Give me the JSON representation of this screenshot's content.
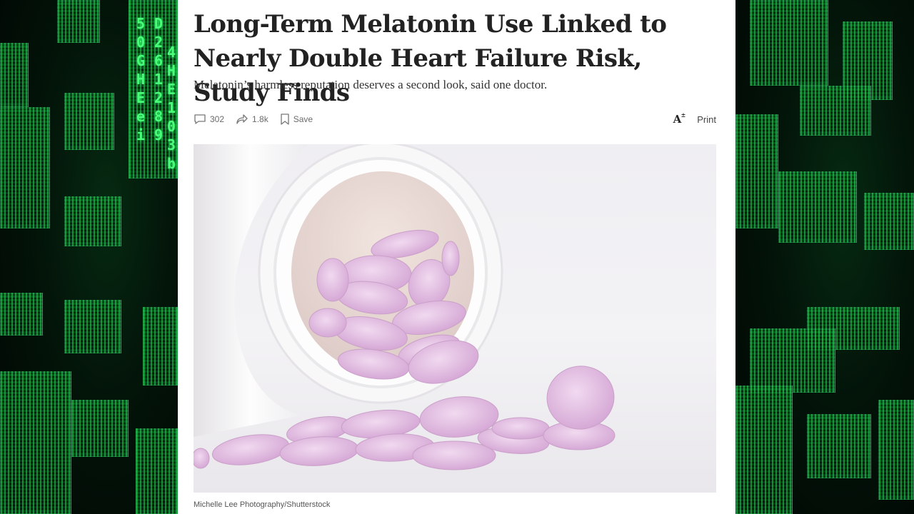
{
  "article": {
    "headline": "Long-Term Melatonin Use Linked to Nearly Double Heart Failure Risk, Study Finds",
    "subheadline": "Melatonin’s harmless reputation deserves a second look, said one doctor.",
    "toolbar": {
      "comments_count": "302",
      "shares_count": "1.8k",
      "save_label": "Save",
      "font_size_label": "A",
      "print_label": "Print",
      "icons": [
        "comment-icon",
        "share-icon",
        "bookmark-icon",
        "font-size-icon"
      ]
    },
    "photo_caption": "Michelle Lee Photography/Shutterstock"
  },
  "background": {
    "left_glyph_column": "5 0 G H E e i",
    "left_glyph_column_2": "D 2 6 1 2 8 9",
    "left_glyph_column_3": "4 H E 1 0 3 b"
  },
  "colors": {
    "matrix_green": "#49ff7a",
    "pill_pink": "#e7c6e6",
    "bottle_white": "#fafafa"
  }
}
